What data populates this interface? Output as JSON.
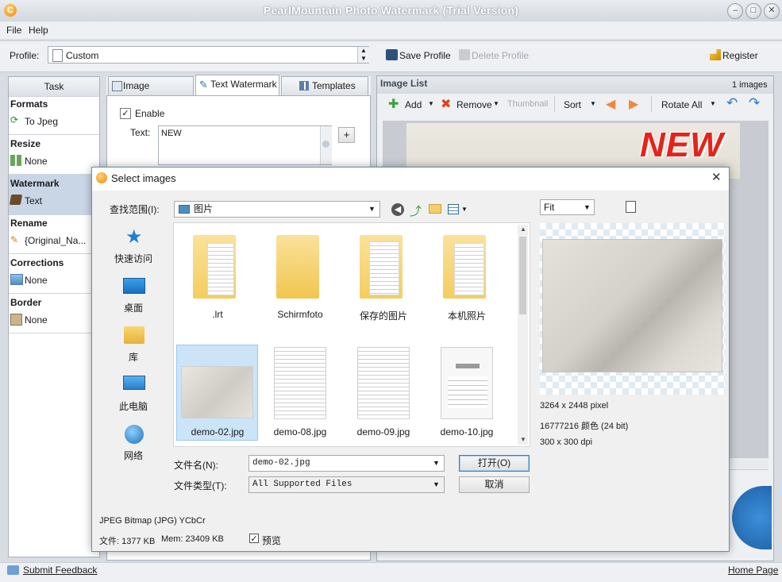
{
  "window": {
    "title": "PearlMountain Photo Watermark (Trial Version)"
  },
  "menu": {
    "file": "File",
    "help": "Help"
  },
  "profile": {
    "label": "Profile:",
    "value": "Custom",
    "save": "Save Profile",
    "delete": "Delete Profile",
    "register": "Register"
  },
  "task": {
    "header": "Task",
    "sections": [
      {
        "title": "Formats",
        "item": "To Jpeg"
      },
      {
        "title": "Resize",
        "item": "None"
      },
      {
        "title": "Watermark",
        "item": "Text"
      },
      {
        "title": "Rename",
        "item": "{Original_Na..."
      },
      {
        "title": "Corrections",
        "item": "None"
      },
      {
        "title": "Border",
        "item": "None"
      }
    ]
  },
  "tabs": {
    "image": "Image Watermark",
    "text": "Text Watermark",
    "templates": "Templates"
  },
  "text_wm": {
    "enable": "Enable",
    "text_label": "Text:",
    "text_value": "NEW",
    "plus": "+"
  },
  "imagelist": {
    "title": "Image List",
    "count": "1 images",
    "add": "Add",
    "remove": "Remove",
    "thumbnail": "Thumbnail",
    "sort": "Sort",
    "rotate_all": "Rotate All",
    "watermark_text": "NEW"
  },
  "status": {
    "feedback": "Submit Feedback",
    "home": "Home Page"
  },
  "dialog": {
    "title": "Select images",
    "lookin_label": "查找范围(I):",
    "lookin_value": "图片",
    "places": [
      "快速访问",
      "桌面",
      "库",
      "此电脑",
      "网络"
    ],
    "files": [
      {
        "name": ".lrt",
        "kind": "folder"
      },
      {
        "name": "Schirmfoto",
        "kind": "folder"
      },
      {
        "name": "保存的图片",
        "kind": "folder"
      },
      {
        "name": "本机照片",
        "kind": "folder"
      },
      {
        "name": "demo-02.jpg",
        "kind": "image"
      },
      {
        "name": "demo-08.jpg",
        "kind": "image"
      },
      {
        "name": "demo-09.jpg",
        "kind": "image"
      },
      {
        "name": "demo-10.jpg",
        "kind": "image"
      }
    ],
    "filename_label": "文件名(N):",
    "filename_value": "demo-02.jpg",
    "filetype_label": "文件类型(T):",
    "filetype_value": "All Supported Files",
    "open": "打开(O)",
    "cancel": "取消",
    "zoom": "Fit",
    "img_size": "3264 x 2448 pixel",
    "img_colors": "16777216 颜色 (24 bit)",
    "img_dpi": "300 x 300 dpi",
    "format": "JPEG Bitmap (JPG) YCbCr",
    "file_size": "文件: 1377 KB",
    "mem": "Mem: 23409 KB",
    "preview": "预览"
  },
  "colors": {
    "accent_blue": "#3a87d6",
    "selection": "#cce4f7",
    "watermark_red": "#e8221a"
  }
}
